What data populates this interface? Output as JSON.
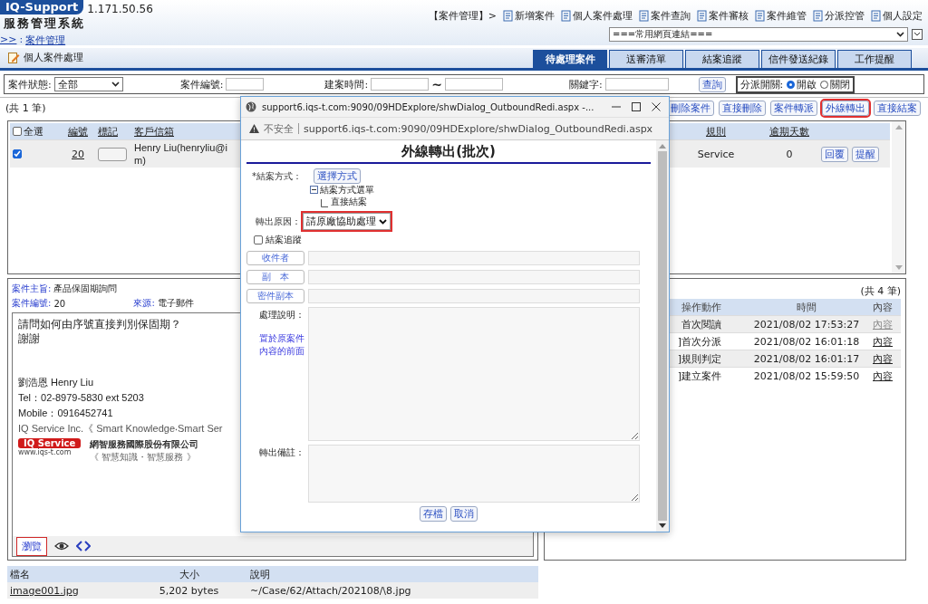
{
  "header": {
    "logo": "IQ-Support",
    "ip": "1.171.50.56",
    "system_name": "服務管理系統",
    "breadcrumb_home": ">>",
    "breadcrumb_sep": ":",
    "breadcrumb_current": "案件管理",
    "module": "【案件管理】>",
    "nav": [
      "新增案件",
      "個人案件處理",
      "案件查詢",
      "案件審核",
      "案件維管",
      "分派控管",
      "個人設定"
    ],
    "links_select": "===常用網頁連結==="
  },
  "page_title": "個人案件處理",
  "tabs": [
    {
      "label": "待處理案件",
      "selected": true
    },
    {
      "label": "送審清單",
      "selected": false
    },
    {
      "label": "結案追蹤",
      "selected": false
    },
    {
      "label": "信件發送紀錄",
      "selected": false
    },
    {
      "label": "工作提醒",
      "selected": false
    }
  ],
  "filters": {
    "status_label": "案件狀態:",
    "status_value": "全部",
    "case_no_label": "案件編號:",
    "date_label": "建案時間:",
    "date_sep": "~",
    "keyword_label": "關鍵字:",
    "search_button": "查詢",
    "dispatch_label": "分派開關:",
    "dispatch_options": [
      {
        "label": "開啟",
        "selected": true
      },
      {
        "label": "關閉",
        "selected": false
      }
    ]
  },
  "case_list": {
    "count": "(共 1 筆)",
    "actions": [
      {
        "label": "刪除案件",
        "highlighted": false
      },
      {
        "label": "直接刪除",
        "highlighted": false
      },
      {
        "label": "案件轉派",
        "highlighted": false
      },
      {
        "label": "外線轉出",
        "highlighted": true
      },
      {
        "label": "直接結案",
        "highlighted": false
      }
    ],
    "select_all": {
      "label": "全選",
      "checked": false
    },
    "columns": [
      "編號",
      "標記",
      "客戶信箱",
      "規則",
      "逾期天數"
    ],
    "rows": [
      {
        "checked": true,
        "number": "20",
        "email_lines": [
          "Henry Liu(henryliu@i",
          "m)"
        ],
        "rule": "Service",
        "overdue_days": "0",
        "buttons": [
          "回覆",
          "提醒"
        ]
      }
    ]
  },
  "case_detail": {
    "subject_label": "案件主旨:",
    "subject": "產品保固期詢問",
    "number_label": "案件編號:",
    "number": "20",
    "source_label": "來源:",
    "source": "電子郵件",
    "question_lines": [
      "請問如何由序號直接判別保固期？",
      "謝謝"
    ],
    "signature_lines": [
      "劉浩恩 Henry Liu",
      "Tel：02-8979-5830 ext 5203",
      "Mobile：0916452741",
      "IQ Service Inc.《 Smart Knowledge‧Smart Ser"
    ],
    "logo_text": "IQ Service",
    "logo_url": "www.iqs-t.com",
    "company": "網智服務國際股份有限公司",
    "slogan": "《 智慧知識・智慧服務 》",
    "browse_button": "瀏覽",
    "browse_highlighted": true
  },
  "attachments": {
    "columns": [
      "檔名",
      "大小",
      "說明"
    ],
    "rows": [
      {
        "name": "image001.jpg",
        "size": "5,202 bytes",
        "path": "~/Case/62/Attach/202108/\\8.jpg"
      }
    ]
  },
  "history": {
    "count": "(共 4 筆)",
    "columns": [
      "操作動作",
      "時間",
      "內容"
    ],
    "rows": [
      {
        "action": "首次閱讀",
        "time": "2021/08/02 17:53:27",
        "content": "內容",
        "disabled": true
      },
      {
        "column_1": "]",
        "action": "首次分派",
        "time": "2021/08/02 16:01:18",
        "content": "內容",
        "disabled": false
      },
      {
        "column_1": "]",
        "action": "規則判定",
        "time": "2021/08/02 16:01:17",
        "content": "內容",
        "disabled": false
      },
      {
        "column_1": "]",
        "action": "建立案件",
        "time": "2021/08/02 15:59:50",
        "content": "內容",
        "disabled": false
      }
    ]
  },
  "dialog": {
    "window_title": "support6.iqs-t.com:9090/09HDExplore/shwDialog_OutboundRedi.aspx -...",
    "security_label": "不安全",
    "url": "support6.iqs-t.com:9090/09HDExplore/shwDialog_OutboundRedi.aspx",
    "heading": "外線轉出(批次)",
    "close_method_label": "*結案方式：",
    "close_method_button": "選擇方式",
    "tree": [
      {
        "label": "結案方式選單",
        "expanded": true,
        "children": [
          {
            "label": "直接結案"
          }
        ]
      }
    ],
    "reason_label": "轉出原因：",
    "reason_value": "請原廠協助處理",
    "reason_highlighted": true,
    "follow_up": {
      "label": "結案追蹤",
      "checked": false
    },
    "recipients": [
      "收件者",
      "副　本",
      "密件副本"
    ],
    "description_label": "處理說明：",
    "description_hint": "置於原案件內容的前面",
    "remark_label": "轉出備註：",
    "buttons": [
      "存檔",
      "取消"
    ]
  }
}
